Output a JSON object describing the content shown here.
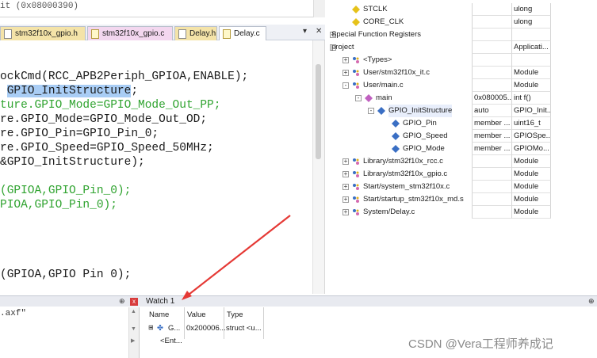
{
  "top_output": {
    "text": "it (0x08000390)"
  },
  "tabs": [
    {
      "label": "stm32f10x_gpio.h",
      "kind": "h"
    },
    {
      "label": "stm32f10x_gpio.c",
      "kind": "c"
    },
    {
      "label": "Delay.h",
      "kind": "h"
    },
    {
      "label": "Delay.c",
      "kind": "c"
    }
  ],
  "tab_controls": {
    "menu": "▾",
    "close": "✕"
  },
  "code": {
    "l1": "ockCmd(RCC_APB2Periph_GPIOA,ENABLE);",
    "l2_hl": "GPIO_InitStructure",
    "l2_rest": ";",
    "l3": "ture.GPIO_Mode=GPIO_Mode_Out_PP;",
    "l4": "re.GPIO_Mode=GPIO_Mode_Out_OD;",
    "l5": "re.GPIO_Pin=GPIO_Pin_0;",
    "l6": "re.GPIO_Speed=GPIO_Speed_50MHz;",
    "l7": "&GPIO_InitStructure);",
    "l8": "(GPIOA,GPIO_Pin_0);",
    "l9": "PIOA,GPIO_Pin_0);",
    "l10": "(GPIOA,GPIO Pin 0);"
  },
  "tree": {
    "rows": [
      {
        "name": "STCLK",
        "value": "",
        "type": "ulong"
      },
      {
        "name": "CORE_CLK",
        "value": "",
        "type": "ulong"
      },
      {
        "name": "Special Function Registers",
        "value": "",
        "type": ""
      },
      {
        "name": "project",
        "value": "",
        "type": "Applicati..."
      },
      {
        "name": "<Types>",
        "value": "",
        "type": ""
      },
      {
        "name": "User/stm32f10x_it.c",
        "value": "",
        "type": "Module"
      },
      {
        "name": "User/main.c",
        "value": "",
        "type": "Module"
      },
      {
        "name": "main",
        "value": "0x080005...",
        "type": "int f()"
      },
      {
        "name": "GPIO_InitStructure",
        "value": "auto",
        "type": "GPIO_Init..."
      },
      {
        "name": "GPIO_Pin",
        "value": "member ...",
        "type": "uint16_t"
      },
      {
        "name": "GPIO_Speed",
        "value": "member ...",
        "type": "GPIOSpe..."
      },
      {
        "name": "GPIO_Mode",
        "value": "member ...",
        "type": "GPIOMo..."
      },
      {
        "name": "Library/stm32f10x_rcc.c",
        "value": "",
        "type": "Module"
      },
      {
        "name": "Library/stm32f10x_gpio.c",
        "value": "",
        "type": "Module"
      },
      {
        "name": "Start/system_stm32f10x.c",
        "value": "",
        "type": "Module"
      },
      {
        "name": "Start/startup_stm32f10x_md.s",
        "value": "",
        "type": "Module"
      },
      {
        "name": "System/Delay.c",
        "value": "",
        "type": "Module"
      }
    ]
  },
  "cmd_pane": {
    "text": ".axf\"",
    "pin": "⊕",
    "close": "x"
  },
  "watch": {
    "title": "Watch 1",
    "headers": {
      "name": "Name",
      "value": "Value",
      "type": "Type"
    },
    "rows": [
      {
        "name": "G...",
        "value": "0x200006...",
        "type": "struct <u..."
      },
      {
        "name": "<Ent...",
        "value": "",
        "type": ""
      }
    ],
    "pin": "⊕"
  },
  "watermark": "CSDN @Vera工程师养成记",
  "colors": {
    "arrow": "#e53935",
    "highlight": "#a9cdf5",
    "code_green": "#2fa32f"
  }
}
